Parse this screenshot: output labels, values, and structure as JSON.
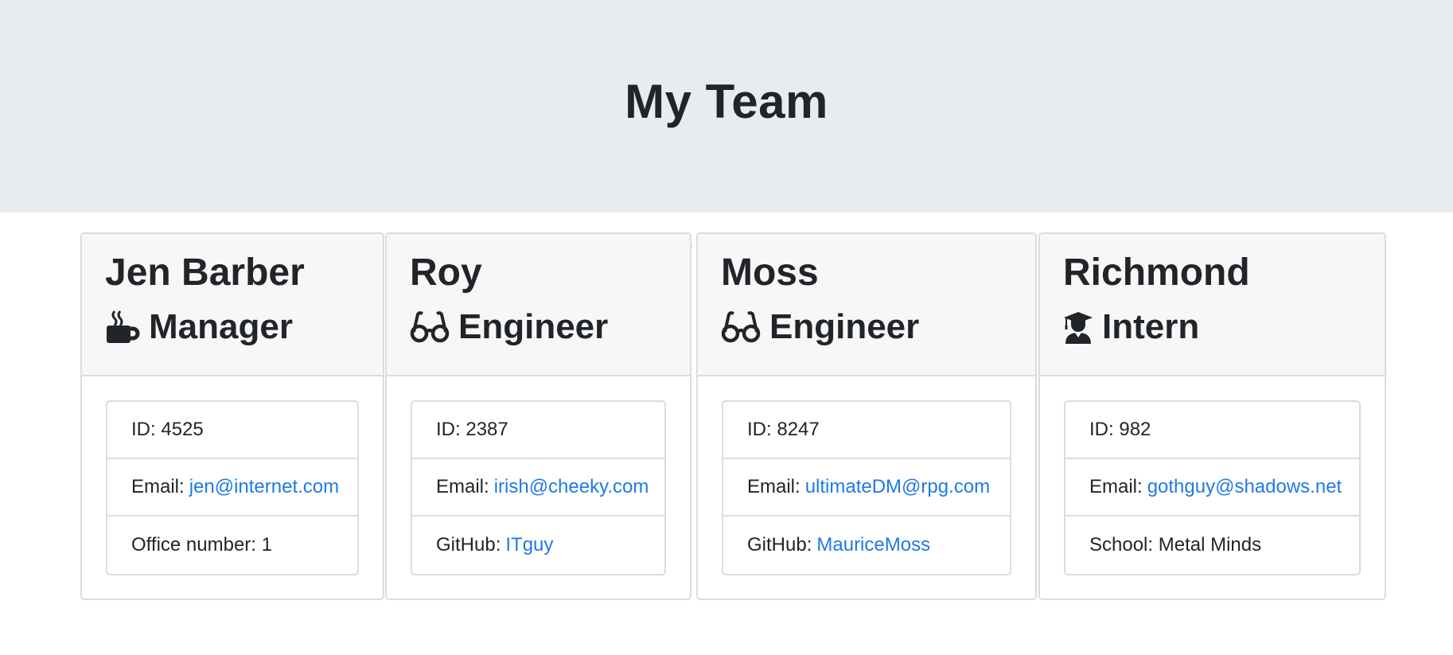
{
  "header": {
    "title": "My Team"
  },
  "team": [
    {
      "name": "Jen Barber",
      "role": "Manager",
      "icon": "mug-icon",
      "id_label": "ID:",
      "id": "4525",
      "email_label": "Email:",
      "email": "jen@internet.com",
      "extra_label": "Office number:",
      "extra": "1"
    },
    {
      "name": "Roy",
      "role": "Engineer",
      "icon": "glasses-icon",
      "id_label": "ID:",
      "id": "2387",
      "email_label": "Email:",
      "email": "irish@cheeky.com",
      "extra_label": "GitHub:",
      "extra": "ITguy"
    },
    {
      "name": "Moss",
      "role": "Engineer",
      "icon": "glasses-icon",
      "id_label": "ID:",
      "id": "8247",
      "email_label": "Email:",
      "email": "ultimateDM@rpg.com",
      "extra_label": "GitHub:",
      "extra": "MauriceMoss"
    },
    {
      "name": "Richmond",
      "role": "Intern",
      "icon": "graduate-icon",
      "id_label": "ID:",
      "id": "982",
      "email_label": "Email:",
      "email": "gothguy@shadows.net",
      "extra_label": "School:",
      "extra": "Metal Minds"
    }
  ],
  "stray_mark": "'",
  "colors": {
    "header_bg": "#e9ecef",
    "link": "#1f7ae6",
    "card_header_bg": "#f7f7f7"
  }
}
